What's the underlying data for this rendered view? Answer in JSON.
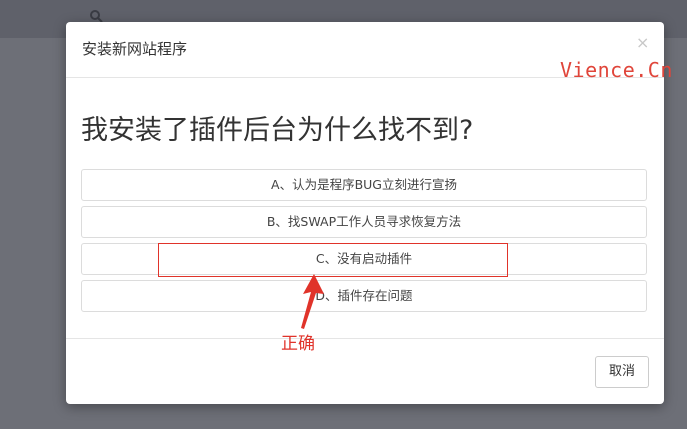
{
  "modal": {
    "title": "安装新网站程序",
    "close_symbol": "×",
    "question": "我安装了插件后台为什么找不到?",
    "options": [
      "A、认为是程序BUG立刻进行宣扬",
      "B、找SWAP工作人员寻求恢复方法",
      "C、没有启动插件",
      "D、插件存在问题"
    ],
    "cancel_label": "取消"
  },
  "overlay": {
    "watermark": "Vience.Cn",
    "annotation_label": "正确"
  },
  "colors": {
    "accent_red": "#e0332a",
    "backdrop": "#6d6f77"
  },
  "icons": {
    "background": "search-icon",
    "close": "close-icon",
    "annotation": "arrow-up-icon"
  }
}
